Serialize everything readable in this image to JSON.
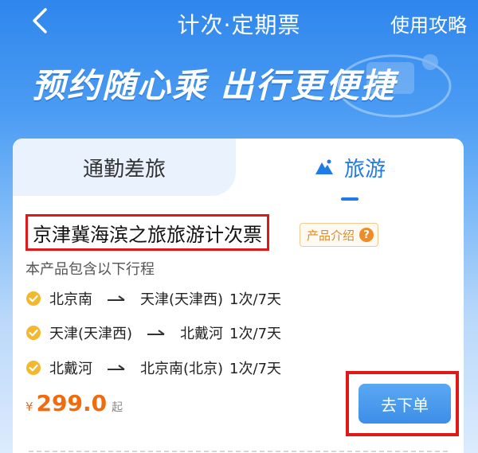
{
  "header": {
    "title": "计次·定期票",
    "guide_link": "使用攻略",
    "back_icon": "chevron-left-icon"
  },
  "banner": {
    "slogan": "预约随心乘 出行更便捷"
  },
  "tabs": [
    {
      "label": "通勤差旅",
      "active": false
    },
    {
      "label": "旅游",
      "active": true,
      "icon": "mountain-icon"
    }
  ],
  "product": {
    "title": "京津冀海滨之旅旅游计次票",
    "intro_tag": "产品介绍",
    "intro_icon": "question-icon",
    "includes_label": "本产品包含以下行程",
    "routes": [
      {
        "from": "北京南",
        "to": "天津(天津西)",
        "frequency": "1次/7天"
      },
      {
        "from": "天津(天津西)",
        "to": "北戴河",
        "frequency": "1次/7天"
      },
      {
        "from": "北戴河",
        "to": "北京南(北京)",
        "frequency": "1次/7天"
      }
    ],
    "price": {
      "currency": "¥",
      "amount": "299.0",
      "suffix": "起"
    },
    "order_button": "去下单"
  },
  "colors": {
    "accent_blue": "#1f7be8",
    "price_orange": "#f06a0e",
    "highlight_red": "#e01818",
    "check_gold": "#f2b92e"
  }
}
